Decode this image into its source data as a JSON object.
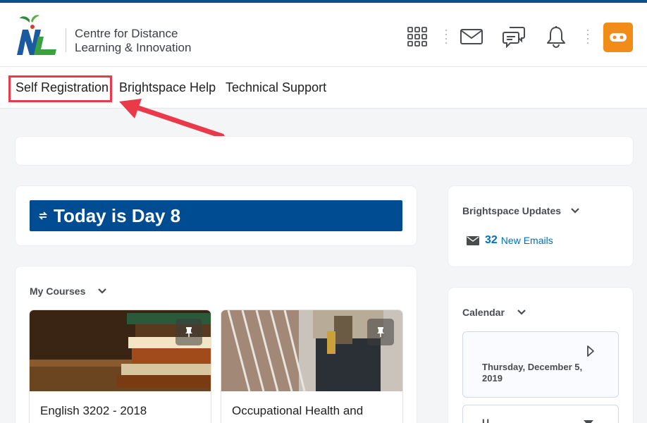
{
  "brand": {
    "name_line1": "Centre for Distance",
    "name_line2": "Learning & Innovation",
    "logo_letters": "NL"
  },
  "header": {
    "icons": [
      "app-grid-icon",
      "mail-icon",
      "chat-icon",
      "bell-icon",
      "avatar-icon"
    ],
    "accent_color": "#f08c17",
    "top_border_color": "#0b4f8c"
  },
  "nav": {
    "links": [
      "Self Registration",
      "Brightspace Help",
      "Technical Support"
    ],
    "highlight_color": "#ea3a4a"
  },
  "banner": {
    "text": "Today is Day 8",
    "color": "#004c93"
  },
  "my_courses": {
    "title": "My Courses",
    "courses": [
      {
        "title": "English 3202 - 2018"
      },
      {
        "title": "Occupational Health and"
      }
    ]
  },
  "updates": {
    "title": "Brightspace Updates",
    "email_count": "32",
    "email_label": "New Emails"
  },
  "calendar": {
    "title": "Calendar",
    "date": "Thursday, December 5, 2019",
    "next_section_text": "U"
  }
}
